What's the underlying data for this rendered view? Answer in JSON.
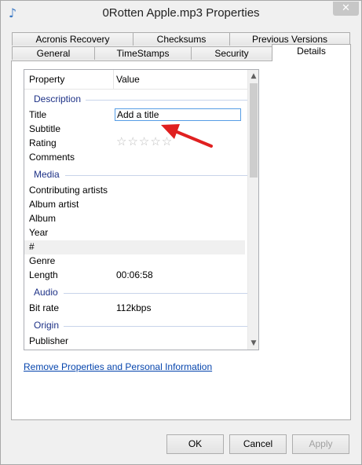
{
  "window": {
    "title": "0Rotten Apple.mp3 Properties",
    "close_glyph": "✕",
    "app_icon": "music-note-icon"
  },
  "tabs_top": [
    {
      "label": "Acronis Recovery"
    },
    {
      "label": "Checksums"
    },
    {
      "label": "Previous Versions"
    }
  ],
  "tabs_bottom": [
    {
      "label": "General"
    },
    {
      "label": "TimeStamps"
    },
    {
      "label": "Security"
    },
    {
      "label": "Details",
      "active": true
    }
  ],
  "details": {
    "header": {
      "property": "Property",
      "value": "Value"
    },
    "groups": {
      "description": "Description",
      "media": "Media",
      "audio": "Audio",
      "origin": "Origin"
    },
    "props": {
      "title": "Title",
      "subtitle": "Subtitle",
      "rating": "Rating",
      "comments": "Comments",
      "contributing_artists": "Contributing artists",
      "album_artist": "Album artist",
      "album": "Album",
      "year": "Year",
      "number": "#",
      "genre": "Genre",
      "length": "Length",
      "bit_rate": "Bit rate",
      "publisher": "Publisher"
    },
    "values": {
      "title_placeholder": "Add a title",
      "rating_stars": "☆☆☆☆☆",
      "length": "00:06:58",
      "bit_rate": "112kbps"
    },
    "scroll_up": "▲",
    "scroll_down": "▼"
  },
  "remove_link": "Remove Properties and Personal Information",
  "buttons": {
    "ok": "OK",
    "cancel_prefix": "",
    "cancel": "Cancel",
    "apply": "Apply"
  },
  "annotation_color": "#e02020"
}
